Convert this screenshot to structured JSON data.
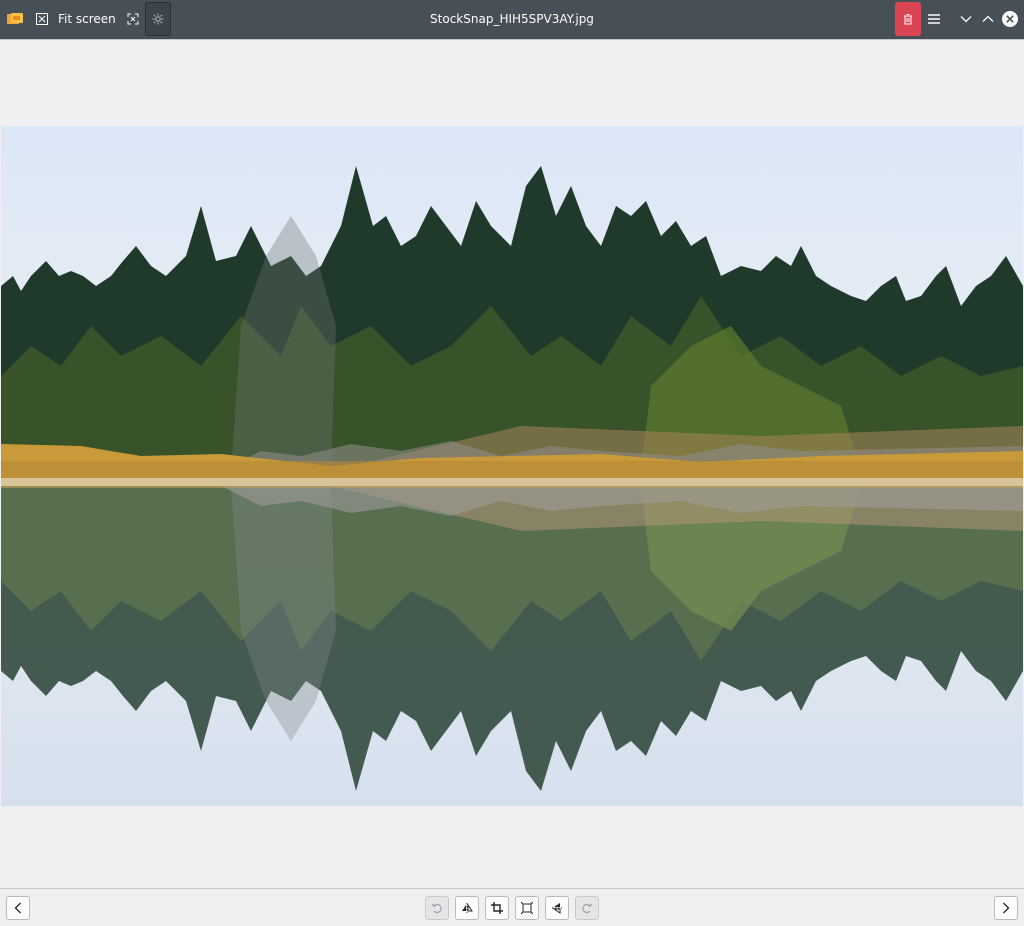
{
  "window": {
    "title": "StockSnap_HIH5SPV3AY.jpg"
  },
  "toolbar": {
    "fit_label": "Fit screen"
  },
  "icons": {
    "app": "image-viewer-icon",
    "fit": "fit-screen-icon",
    "fullscreen": "fullscreen-icon",
    "settings": "settings-gear-icon",
    "trash": "trash-icon",
    "menu": "hamburger-menu-icon",
    "minimize": "chevron-down-icon",
    "maximize": "chevron-up-icon",
    "close": "close-icon",
    "prev": "chevron-left-icon",
    "next": "chevron-right-icon",
    "rotate_left": "rotate-left-icon",
    "flip_horizontal": "flip-horizontal-icon",
    "crop": "crop-icon",
    "resize": "resize-icon",
    "flip_vertical": "flip-vertical-icon",
    "rotate_right": "rotate-right-icon"
  },
  "colors": {
    "titlebar": "#475057",
    "trash_accent": "#da4453",
    "background": "#eff0f1",
    "sky": "#dde7f5",
    "forest": "#1f3a2a",
    "grass": "#c99a3a"
  }
}
